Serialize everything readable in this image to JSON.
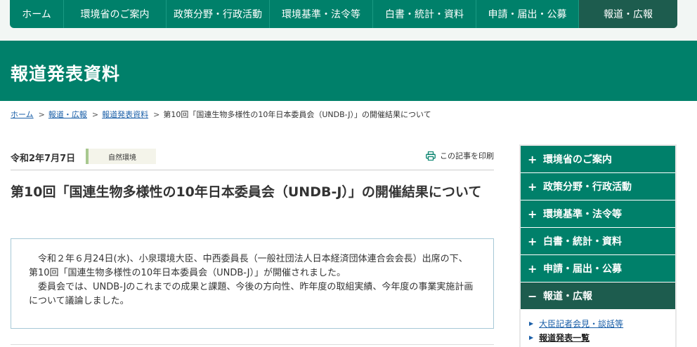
{
  "topnav": {
    "items": [
      {
        "label": "ホーム"
      },
      {
        "label": "環境省のご案内"
      },
      {
        "label": "政策分野・行政活動"
      },
      {
        "label": "環境基準・法令等"
      },
      {
        "label": "白書・統計・資料"
      },
      {
        "label": "申請・届出・公募"
      },
      {
        "label": "報道・広報"
      }
    ],
    "active_index": 6
  },
  "page_header": {
    "title": "報道発表資料"
  },
  "breadcrumb": {
    "items": [
      {
        "label": "ホーム"
      },
      {
        "label": "報道・広報"
      },
      {
        "label": "報道発表資料"
      }
    ],
    "separator": ">",
    "current": "第10回「国連生物多様性の10年日本委員会（UNDB-J）」の開催結果について"
  },
  "article": {
    "date": "令和2年7月7日",
    "tag": "自然環境",
    "print_label": "この記事を印刷",
    "title": "第10回「国連生物多様性の10年日本委員会（UNDB-J）」の開催結果について",
    "summary": [
      "令和２年６月24日(水)、小泉環境大臣、中西委員長（一般社団法人日本経済団体連合会会長）出席の下、第10回「国連生物多様性の10年日本委員会（UNDB-J）」が開催されました。",
      "委員会では、UNDB-Jのこれまでの成果と課題、今後の方向性、昨年度の取組実績、今年度の事業実施計画について議論しました。"
    ]
  },
  "sidebar": {
    "items": [
      {
        "symbol": "+",
        "label": "環境省のご案内"
      },
      {
        "symbol": "+",
        "label": "政策分野・行政活動"
      },
      {
        "symbol": "+",
        "label": "環境基準・法令等"
      },
      {
        "symbol": "+",
        "label": "白書・統計・資料"
      },
      {
        "symbol": "+",
        "label": "申請・届出・公募"
      },
      {
        "symbol": "−",
        "label": "報道・広報"
      }
    ],
    "sub_items": [
      {
        "label": "大臣記者会見・談話等"
      },
      {
        "label": "報道発表一覧"
      }
    ]
  },
  "colors": {
    "brand_green": "#00806a",
    "active_green": "#1d5c4e",
    "link_blue": "#1a5fa8"
  }
}
